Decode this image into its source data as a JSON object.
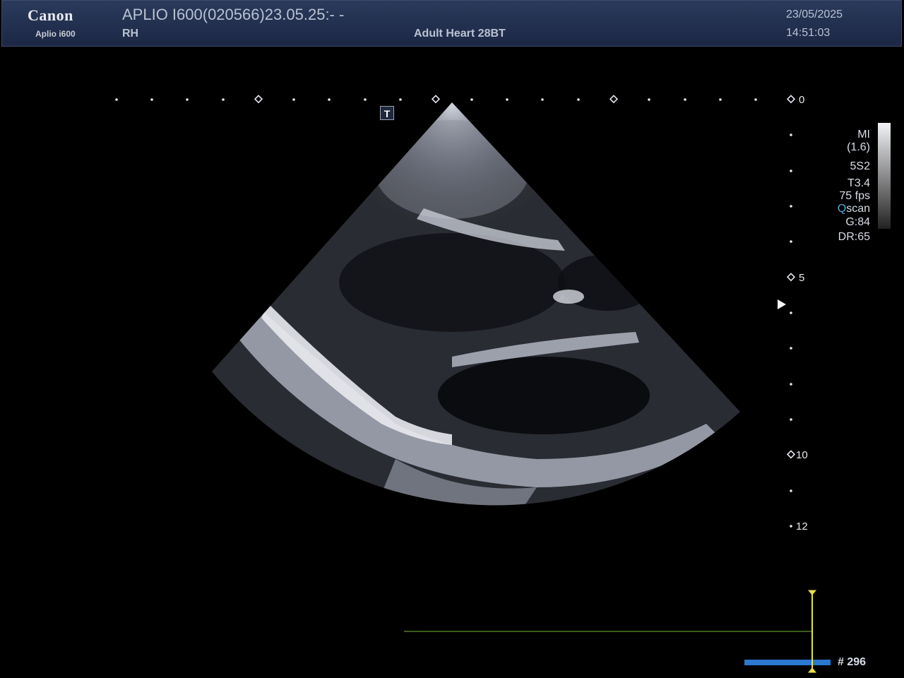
{
  "header": {
    "brand": "Canon",
    "model": "Aplio i600",
    "title": "APLIO I600(020566)23.05.25:- -",
    "probe_side": "RH",
    "preset": "Adult Heart 28BT",
    "date": "23/05/2025",
    "time": "14:51:03"
  },
  "params": {
    "mi": "MI",
    "mi_value": "(1.6)",
    "probe": "5S2",
    "thi": "T3.4",
    "fps": "75 fps",
    "qscan_q": "Q",
    "qscan_rest": "scan",
    "gain": "G:84",
    "dr": "DR:65"
  },
  "depth_scale": {
    "labels": [
      "0",
      "5",
      "10",
      "12"
    ]
  },
  "marker": "T",
  "cine": {
    "frame": "# 296"
  },
  "colors": {
    "header_bg": "#22304f",
    "text": "#b9c1d2",
    "qscan_accent": "#58a8d8",
    "cine_bar": "#2a78d0",
    "cine_cursor": "#e8e24a",
    "ecg_line": "#7ab830"
  }
}
